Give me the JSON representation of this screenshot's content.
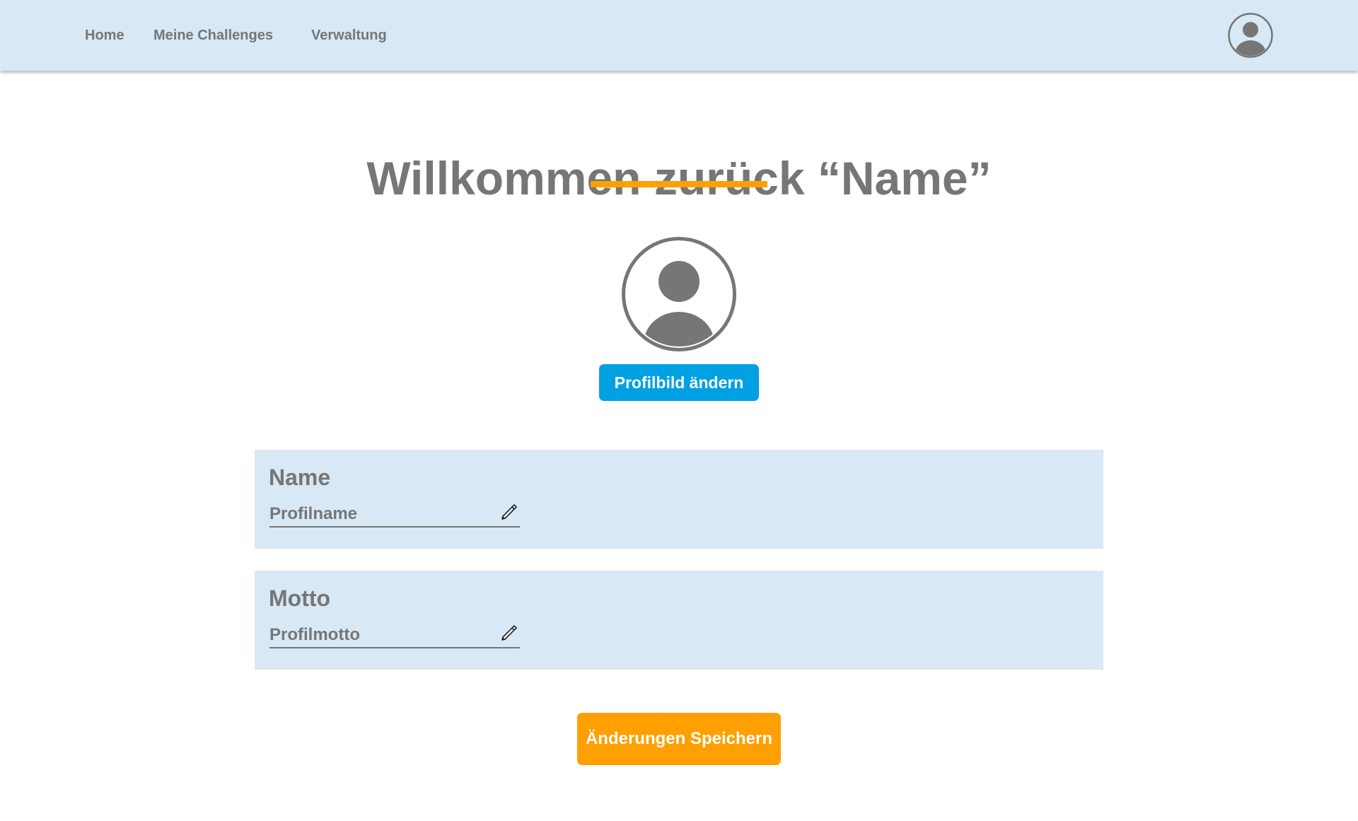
{
  "nav": {
    "items": [
      {
        "label": "Home"
      },
      {
        "label": "Meine Challenges"
      },
      {
        "label": "Verwaltung"
      }
    ],
    "avatar_icon": "user-circle-icon"
  },
  "main": {
    "title": "Willkommen zurück “Name”",
    "profile_icon": "user-circle-icon",
    "change_picture_label": "Profilbild ändern",
    "sections": [
      {
        "label": "Name",
        "placeholder": "Profilname",
        "edit_icon": "pencil-icon"
      },
      {
        "label": "Motto",
        "placeholder": "Profilmotto",
        "edit_icon": "pencil-icon"
      }
    ],
    "save_label": "Änderungen Speichern"
  },
  "colors": {
    "nav_background": "#d8e8f5",
    "text": "#767676",
    "accent_orange": "#ff9f00",
    "accent_blue": "#00a0e3"
  }
}
